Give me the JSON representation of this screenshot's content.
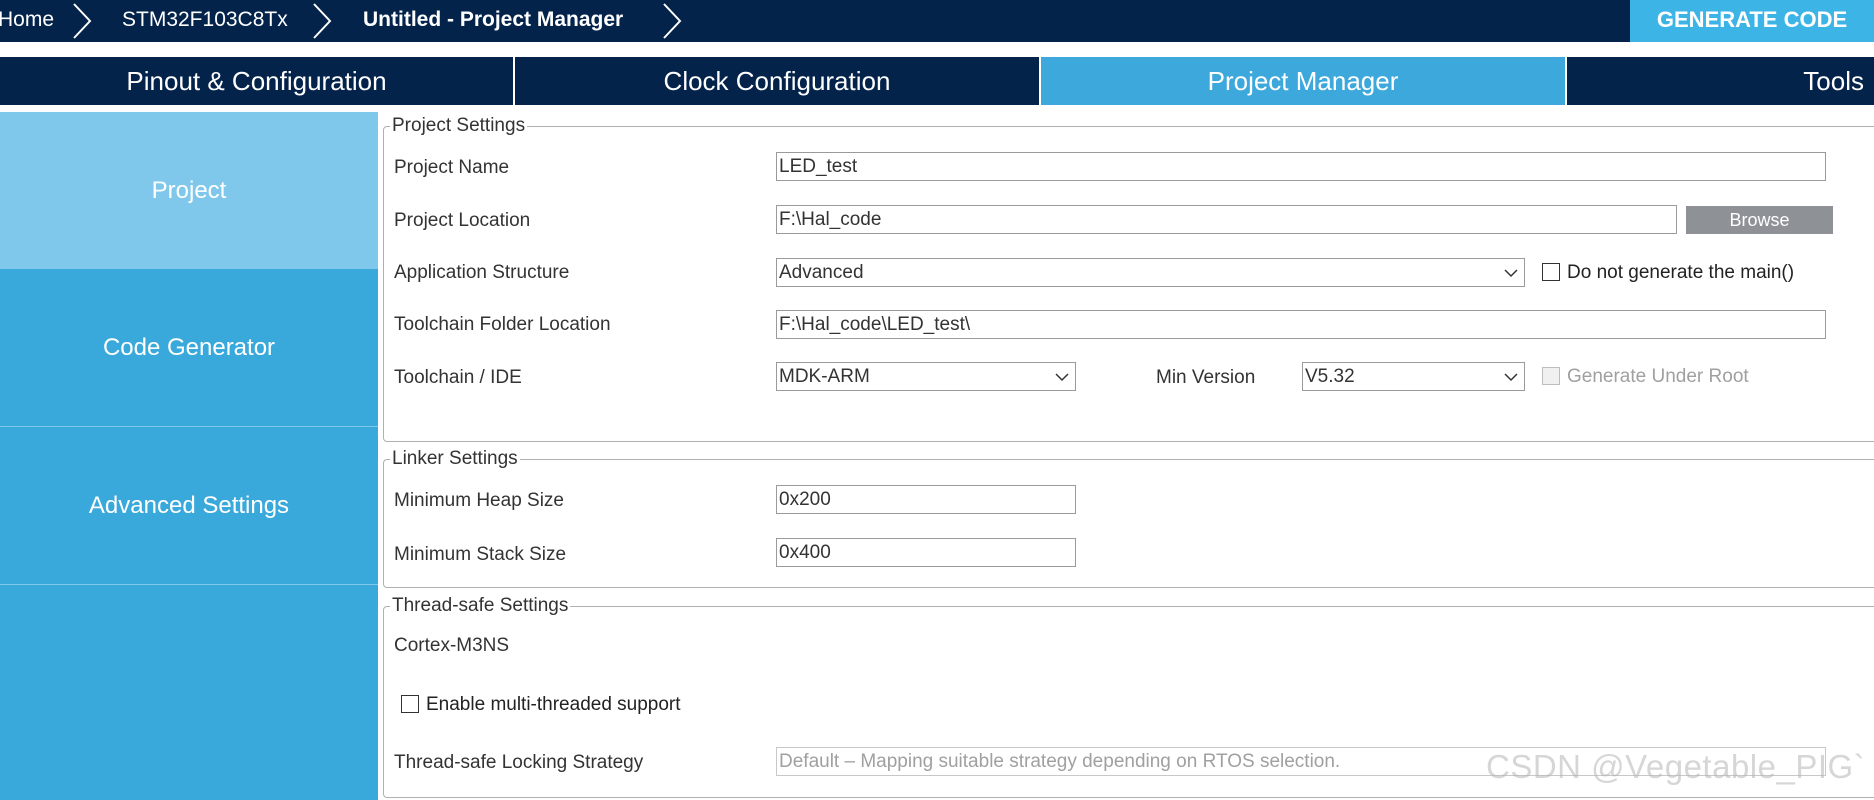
{
  "breadcrumb": {
    "items": [
      "Home",
      "STM32F103C8Tx",
      "Untitled - Project Manager"
    ],
    "generate_label": "GENERATE CODE"
  },
  "tabs": [
    {
      "label": "Pinout & Configuration",
      "active": false
    },
    {
      "label": "Clock Configuration",
      "active": false
    },
    {
      "label": "Project Manager",
      "active": true
    },
    {
      "label": "Tools",
      "active": false
    }
  ],
  "sidebar": {
    "items": [
      {
        "label": "Project",
        "active": true
      },
      {
        "label": "Code Generator",
        "active": false
      },
      {
        "label": "Advanced Settings",
        "active": false
      }
    ]
  },
  "project_settings": {
    "legend": "Project Settings",
    "project_name_label": "Project Name",
    "project_name_value": "LED_test",
    "project_location_label": "Project Location",
    "project_location_value": "F:\\Hal_code",
    "browse_label": "Browse",
    "app_structure_label": "Application Structure",
    "app_structure_value": "Advanced",
    "no_main_label": "Do not generate the main()",
    "no_main_checked": false,
    "toolchain_folder_label": "Toolchain Folder Location",
    "toolchain_folder_value": "F:\\Hal_code\\LED_test\\",
    "toolchain_ide_label": "Toolchain / IDE",
    "toolchain_ide_value": "MDK-ARM",
    "min_version_label": "Min Version",
    "min_version_value": "V5.32",
    "gen_under_root_label": "Generate Under Root",
    "gen_under_root_checked": false
  },
  "linker_settings": {
    "legend": "Linker Settings",
    "heap_label": "Minimum Heap Size",
    "heap_value": "0x200",
    "stack_label": "Minimum Stack Size",
    "stack_value": "0x400"
  },
  "thread_safe_settings": {
    "legend": "Thread-safe Settings",
    "core_label": "Cortex-M3NS",
    "multithread_label": "Enable multi-threaded support",
    "multithread_checked": false,
    "locking_label": "Thread-safe Locking Strategy",
    "locking_value": "Default  –  Mapping suitable strategy depending on RTOS selection."
  },
  "watermark": "CSDN @Vegetable_PIG`",
  "colors": {
    "navy": "#03234b",
    "accent": "#3cb4e6",
    "active_tab": "#3ca8dc",
    "sidebar": "#39a9dc",
    "sidebar_active": "#7fc8ec"
  }
}
